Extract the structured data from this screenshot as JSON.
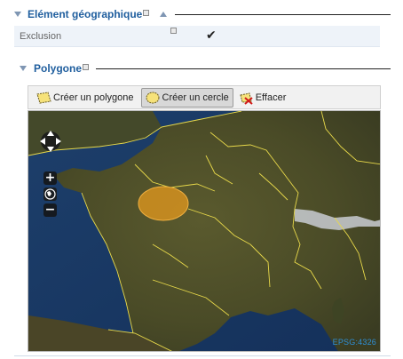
{
  "section1": {
    "title": "Elément géographique"
  },
  "exclusion": {
    "label": "Exclusion",
    "checked": true,
    "check_glyph": "✔"
  },
  "section2": {
    "title": "Polygone"
  },
  "toolbar": {
    "create_polygon": "Créer un polygone",
    "create_circle": "Créer un cercle",
    "erase": "Effacer"
  },
  "map": {
    "attribution": "EPSG:4326",
    "zoom_in": "+",
    "zoom_out": "−",
    "circle_color": "#e59a1e"
  }
}
